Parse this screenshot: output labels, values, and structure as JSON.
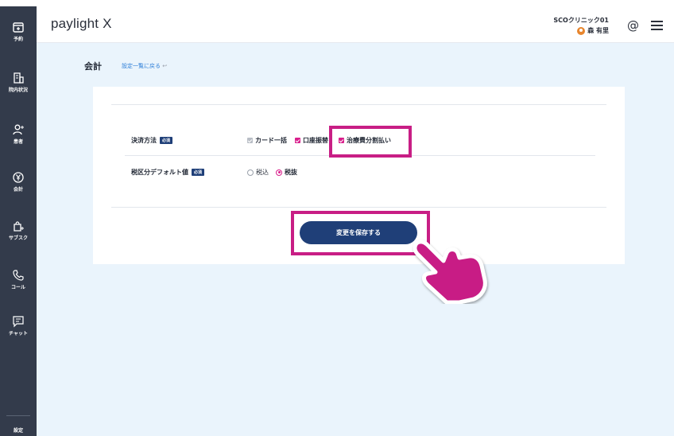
{
  "sidebar": {
    "items": [
      {
        "label": "予約",
        "icon": "calendar-plus-icon"
      },
      {
        "label": "院内状況",
        "icon": "building-icon"
      },
      {
        "label": "患者",
        "icon": "person-add-icon"
      },
      {
        "label": "会計",
        "icon": "yen-coin-icon"
      },
      {
        "label": "サブスク",
        "icon": "bag-plus-icon"
      },
      {
        "label": "コール",
        "icon": "phone-icon"
      },
      {
        "label": "チャット",
        "icon": "chat-icon"
      }
    ],
    "settings_label": "設定"
  },
  "header": {
    "logo": "paylight X",
    "clinic": "SCOクリニック01",
    "user": "森 有里"
  },
  "page": {
    "title": "会計",
    "back_link": "設定一覧に戻る"
  },
  "form": {
    "required_badge": "必須",
    "payment_method": {
      "label": "決済方法",
      "options": [
        {
          "label": "カード一括",
          "checked": true,
          "disabled": true
        },
        {
          "label": "口座振替",
          "checked": true
        },
        {
          "label": "治療費分割払い",
          "checked": true
        }
      ]
    },
    "tax_default": {
      "label": "税区分デフォルト値",
      "options": [
        {
          "label": "税込",
          "selected": false
        },
        {
          "label": "税抜",
          "selected": true
        }
      ]
    },
    "save_label": "変更を保存する"
  },
  "colors": {
    "sidebar": "#333b4b",
    "primary": "#1f3f78",
    "accent": "#d91f8c",
    "highlight": "#c81e85",
    "background": "#eaf4fc"
  }
}
